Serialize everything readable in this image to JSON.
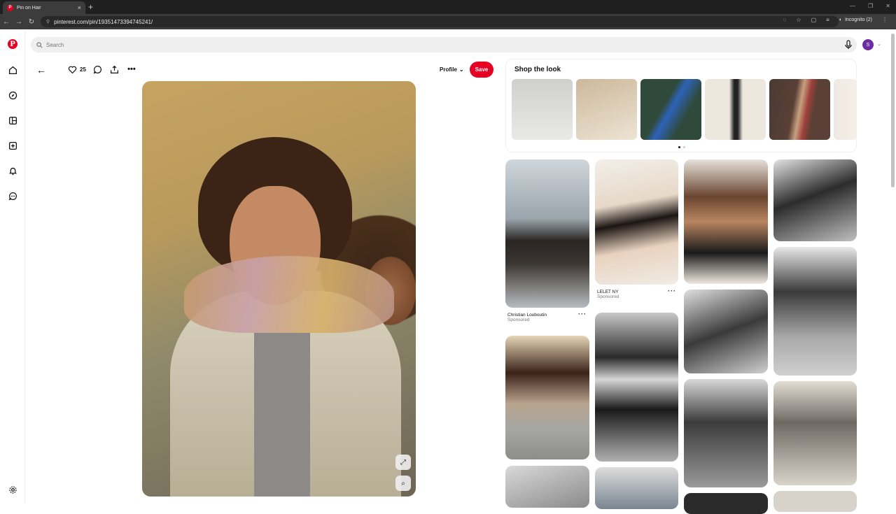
{
  "browser": {
    "tab_title": "Pin on Hair",
    "tab_close": "×",
    "new_tab": "+",
    "url": "pinterest.com/pin/19351473394745241/",
    "incognito_label": "Incognito (2)",
    "window_controls": [
      "—",
      "❐",
      "✕"
    ]
  },
  "search": {
    "placeholder": "Search"
  },
  "user": {
    "avatar_initial": "S"
  },
  "pin": {
    "likes": "25",
    "profile_label": "Profile",
    "save_label": "Save"
  },
  "shop": {
    "title": "Shop the look",
    "item_colors": [
      "#d4d4d2",
      "#e8e0d2",
      "#2f4a3a",
      "#ece8de",
      "#5a4036",
      "#efe9e1"
    ]
  },
  "grid": {
    "card1": {
      "title": "Christian Louboutin",
      "subtitle": "Sponsored"
    },
    "card2": {
      "title": "LELET NY",
      "subtitle": "Sponsored"
    }
  },
  "colors": {
    "brand": "#e60023"
  }
}
